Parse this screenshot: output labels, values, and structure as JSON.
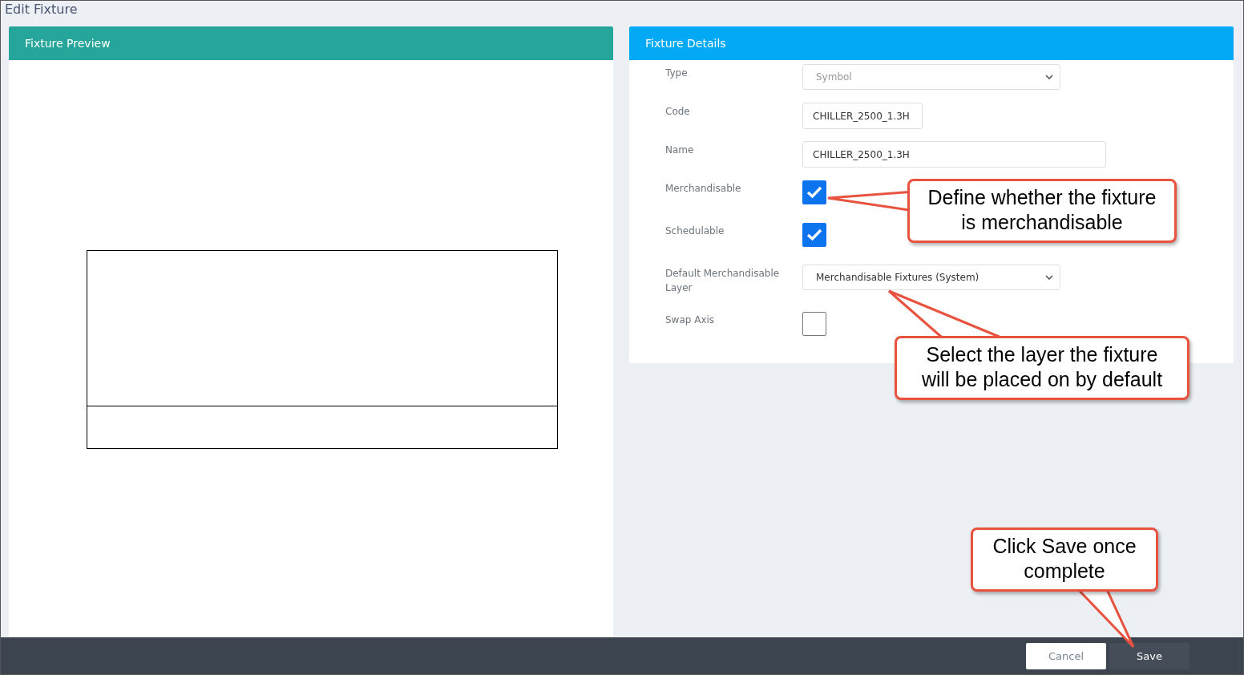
{
  "window": {
    "title": "Edit Fixture"
  },
  "preview": {
    "title": "Fixture Preview"
  },
  "details": {
    "title": "Fixture Details",
    "fields": [
      {
        "kind": "select",
        "label": "Type",
        "value": "Symbol",
        "disabled": true
      },
      {
        "kind": "text",
        "label": "Code",
        "value": "CHILLER_2500_1.3H"
      },
      {
        "kind": "text",
        "label": "Name",
        "value": "CHILLER_2500_1.3H"
      },
      {
        "kind": "checkbox",
        "label": "Merchandisable",
        "checked": true
      },
      {
        "kind": "checkbox",
        "label": "Schedulable",
        "checked": true
      },
      {
        "kind": "select",
        "label": "Default Merchandisable Layer",
        "value": "Merchandisable Fixtures (System)",
        "disabled": false
      },
      {
        "kind": "checkbox",
        "label": "Swap Axis",
        "checked": false
      }
    ]
  },
  "callouts": [
    "Define whether the fixture\nis merchandisable",
    "Select the layer the fixture\nwill be placed on by default",
    "Click Save once\ncomplete"
  ],
  "footer": {
    "buttons": [
      {
        "kind": "secondary",
        "label": "Cancel"
      },
      {
        "kind": "primary",
        "label": "Save"
      }
    ]
  }
}
